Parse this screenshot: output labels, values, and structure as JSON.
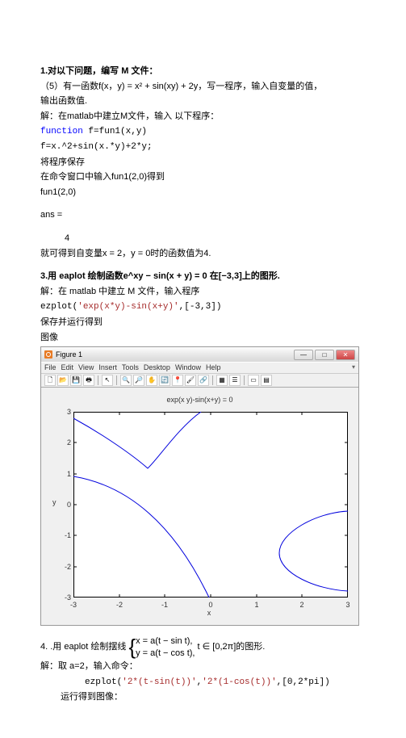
{
  "q1": {
    "heading": "1.对以下问题，编写 M 文件：",
    "problem": "（5）有一函数f(x，y) = x² + sin(xy) + 2y，写一程序，输入自变量的值，",
    "problem2": "输出函数值.",
    "sol_intro": "解：在matlab中建立M文件，输入 以下程序：",
    "code_func": "function",
    "code_sig": " f=fun1(x,y)",
    "code_body": "f=x.^2+sin(x.*y)+2*y;",
    "save": "将程序保存",
    "run": "在命令窗口中输入fun1(2,0)得到",
    "call": "fun1(2,0)",
    "ans_label": "ans =",
    "ans_val": "4",
    "conclusion": "就可得到自变量x = 2，y = 0时的函数值为4."
  },
  "q3": {
    "heading": "3.用 eaplot 绘制函数e^xy − sin(x + y) = 0 在[−3,3]上的图形.",
    "sol_intro": "解：在 matlab 中建立 M 文件，输入程序",
    "code_fn": "ezplot",
    "code_arg_open": "(",
    "code_str": "'exp(x*y)-sin(x+y)'",
    "code_arg_rest": ",[-3,3])",
    "run": "保存并运行得到",
    "img_label": "图像"
  },
  "figure": {
    "title": "Figure 1",
    "menu": [
      "File",
      "Edit",
      "View",
      "Insert",
      "Tools",
      "Desktop",
      "Window",
      "Help"
    ],
    "chart_title": "exp(x y)-sin(x+y) = 0",
    "xlabel": "x",
    "ylabel": "y",
    "xticks": [
      "-3",
      "-2",
      "-1",
      "0",
      "1",
      "2",
      "3"
    ],
    "yticks": [
      "3",
      "2",
      "1",
      "0",
      "-1",
      "-2",
      "-3"
    ]
  },
  "q4": {
    "heading_a": "4. .用 eaplot 绘制摆线",
    "eq1": "x = a(t − sin t),",
    "eq2": "y = a(t − cos t),",
    "heading_b": " t ∈ [0,2π]的图形.",
    "sol": "解：取 a=2，输入命令：",
    "code_fn": "ezplot",
    "code_open": "(",
    "code_s1": "'2*(t-sin(t))'",
    "code_c1": ",",
    "code_s2": "'2*(1-cos(t))'",
    "code_rest": ",[0,2*pi])",
    "run": "运行得到图像："
  },
  "chart_data": {
    "type": "line",
    "title": "exp(x y)-sin(x+y) = 0",
    "xlabel": "x",
    "ylabel": "y",
    "xlim": [
      -3,
      3
    ],
    "ylim": [
      -3,
      3
    ],
    "note": "Implicit curve branches of exp(xy) - sin(x+y) = 0 on [-3,3]×[-3,3]. Three visible branches: upper-left curve from (-3, 2.8) bending down through near (-1.4, 1.2) then up/out to top around (-0.2, 3); a lower-left branch running from about (-3, 0.9) curving down to (-0.05, -3); right branch from (3, -0.2) curving to (1.5, -1.55) then back to (3, -2.8)."
  }
}
